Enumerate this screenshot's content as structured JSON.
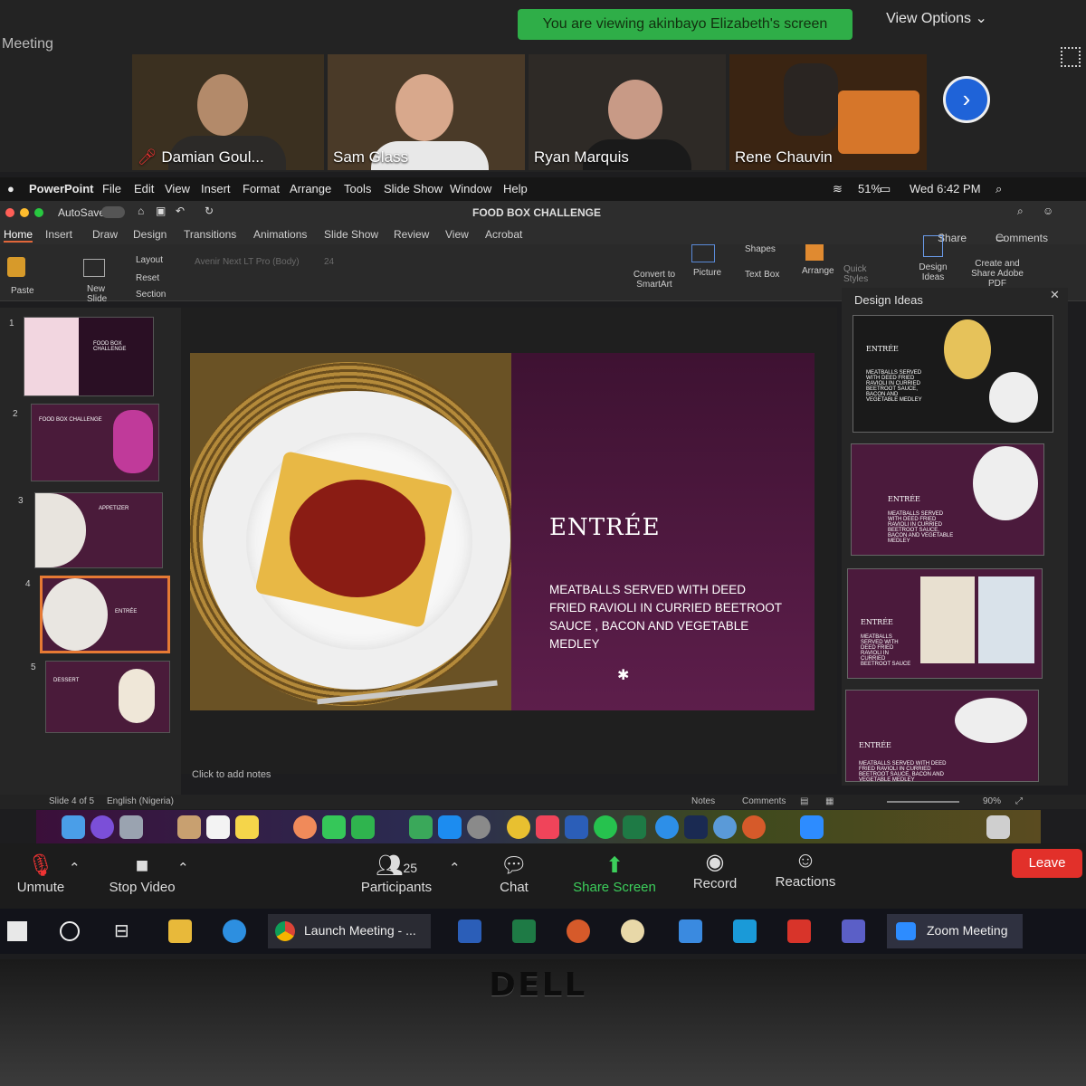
{
  "zoom": {
    "window_title": "Meeting",
    "viewing_banner": "You are viewing akinbayo Elizabeth's screen",
    "view_options": "View Options",
    "participants": [
      {
        "name": "Damian Goul..."
      },
      {
        "name": "Sam Glass"
      },
      {
        "name": "Ryan Marquis"
      },
      {
        "name": "Rene Chauvin"
      }
    ],
    "toolbar": {
      "unmute": "Unmute",
      "stop_video": "Stop Video",
      "participants_label": "Participants",
      "participants_count": "25",
      "chat": "Chat",
      "share_screen": "Share Screen",
      "record": "Record",
      "reactions": "Reactions",
      "leave": "Leave"
    }
  },
  "mac_menubar": {
    "app": "PowerPoint",
    "items": [
      "File",
      "Edit",
      "View",
      "Insert",
      "Format",
      "Arrange",
      "Tools",
      "Slide Show",
      "Window",
      "Help"
    ],
    "battery": "51%",
    "clock": "Wed 6:42 PM"
  },
  "powerpoint": {
    "autosave": "AutoSave",
    "doc_title": "FOOD BOX CHALLENGE",
    "share": "Share",
    "comments": "Comments",
    "tabs": [
      "Home",
      "Insert",
      "Draw",
      "Design",
      "Transitions",
      "Animations",
      "Slide Show",
      "Review",
      "View",
      "Acrobat"
    ],
    "ribbon": {
      "paste": "Paste",
      "new_slide": "New Slide",
      "layout": "Layout",
      "reset": "Reset",
      "section": "Section",
      "font": "Avenir Next LT Pro (Body)",
      "font_size": "24",
      "convert": "Convert to SmartArt",
      "picture": "Picture",
      "shapes": "Shapes",
      "text_box": "Text Box",
      "arrange": "Arrange",
      "quick_styles": "Quick Styles",
      "design_ideas": "Design Ideas",
      "create_share": "Create and Share Adobe PDF"
    },
    "thumbnails": [
      {
        "num": "1",
        "title": "FOOD BOX CHALLENGE"
      },
      {
        "num": "2",
        "title": "FOOD BOX CHALLENGE"
      },
      {
        "num": "3",
        "title": "APPETIZER"
      },
      {
        "num": "4",
        "title": "ENTRÉE"
      },
      {
        "num": "5",
        "title": "DESSERT"
      }
    ],
    "slide": {
      "title": "ENTRÉE",
      "body": "MEATBALLS SERVED WITH DEED FRIED RAVIOLI IN  CURRIED BEETROOT SAUCE , BACON AND VEGETABLE MEDLEY"
    },
    "notes_placeholder": "Click to add notes",
    "design_ideas": {
      "header": "Design Ideas",
      "cards": [
        {
          "title": "ENTRÉE",
          "body": "MEATBALLS SERVED WITH DEED FRIED RAVIOLI IN CURRIED BEETROOT SAUCE, BACON AND VEGETABLE MEDLEY"
        },
        {
          "title": "ENTRÉE",
          "body": "MEATBALLS SERVED WITH DEED FRIED RAVIOLI IN CURRIED BEETROOT SAUCE, BACON AND VEGETABLE MEDLEY"
        },
        {
          "title": "ENTRÉE",
          "body": "MEATBALLS SERVED WITH DEED FRIED RAVIOLI IN CURRIED BEETROOT SAUCE"
        },
        {
          "title": "ENTRÉE",
          "body": "MEATBALLS SERVED WITH DEED FRIED RAVIOLI IN CURRIED BEETROOT SAUCE, BACON AND VEGETABLE MEDLEY"
        }
      ]
    },
    "status": {
      "slide_of": "Slide 4 of 5",
      "language": "English (Nigeria)",
      "notes": "Notes",
      "comments": "Comments",
      "zoom": "90%"
    }
  },
  "windows_taskbar": {
    "chrome_item": "Launch Meeting - ...",
    "zoom_item": "Zoom Meeting"
  },
  "laptop": {
    "brand": "DELL"
  },
  "colors": {
    "zoom_green": "#2fae48",
    "leave_red": "#e2302a",
    "slide_purple": "#5a1e4a",
    "share_screen_green": "#3ccf5b"
  }
}
